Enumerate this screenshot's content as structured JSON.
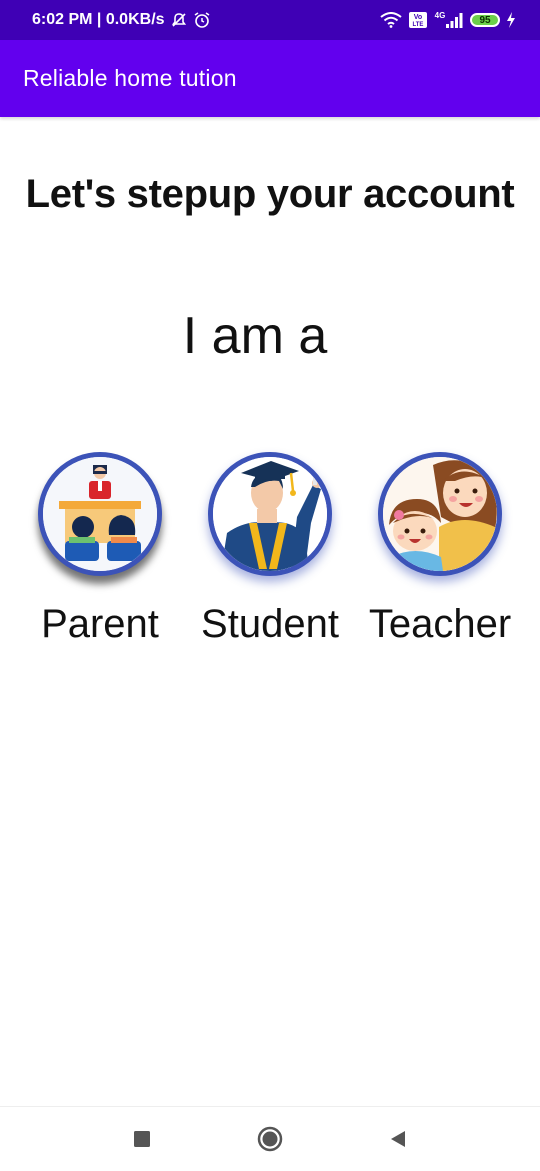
{
  "status_bar": {
    "time_speed": "6:02 PM | 0.0KB/s",
    "network": "4G",
    "battery": "95",
    "volte": "Vo LTE"
  },
  "app_bar": {
    "title": "Reliable home tution"
  },
  "main": {
    "heading": "Let's stepup your account",
    "subheading": "I am a",
    "roles": [
      {
        "label": "Parent",
        "icon": "classroom-illustration"
      },
      {
        "label": "Student",
        "icon": "graduate-illustration"
      },
      {
        "label": "Teacher",
        "icon": "mother-child-illustration"
      }
    ]
  },
  "nav_bar": {
    "buttons": [
      "recents-button",
      "home-button",
      "back-button"
    ]
  },
  "colors": {
    "status_bar": "#3f00b5",
    "app_bar": "#6200ee",
    "circle_border": "#3c53b8"
  }
}
